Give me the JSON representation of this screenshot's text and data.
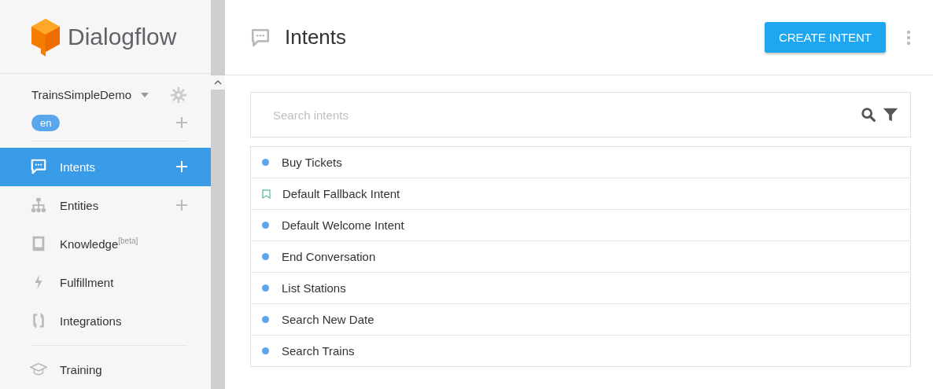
{
  "logo": {
    "text": "Dialogflow"
  },
  "agent": {
    "name": "TrainsSimpleDemo",
    "language": "en"
  },
  "sidebar": {
    "items": [
      {
        "kind": "intents",
        "label": "Intents",
        "selected": true,
        "addable": true
      },
      {
        "kind": "entities",
        "label": "Entities",
        "selected": false,
        "addable": true
      },
      {
        "kind": "knowledge",
        "label": "Knowledge$^{[beta]}$",
        "selected": false,
        "addable": false
      },
      {
        "kind": "fulfillment",
        "label": "Fulfillment",
        "selected": false,
        "addable": false
      },
      {
        "kind": "integrations",
        "label": "Integrations",
        "selected": false,
        "addable": false
      },
      {
        "kind": "training",
        "label": "Training",
        "selected": false,
        "addable": false
      }
    ]
  },
  "header": {
    "title": "Intents",
    "button": "CREATE INTENT"
  },
  "search": {
    "placeholder": "Search intents"
  },
  "intents": [
    {
      "kind": "dot",
      "name": "Buy Tickets"
    },
    {
      "kind": "fallback",
      "name": "Default Fallback Intent"
    },
    {
      "kind": "dot",
      "name": "Default Welcome Intent"
    },
    {
      "kind": "dot",
      "name": "End Conversation"
    },
    {
      "kind": "dot",
      "name": "List Stations"
    },
    {
      "kind": "dot",
      "name": "Search New Date"
    },
    {
      "kind": "dot",
      "name": "Search Trains"
    }
  ]
}
